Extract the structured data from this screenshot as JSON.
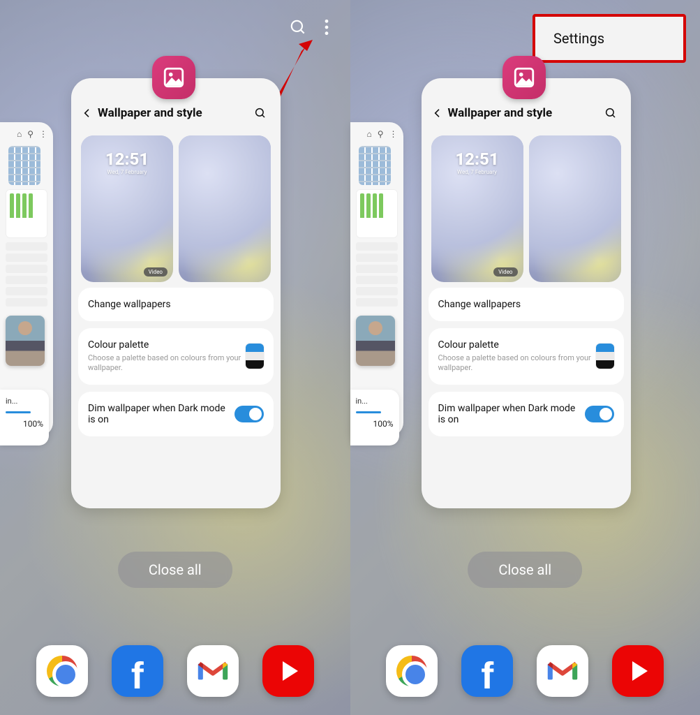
{
  "panels": {
    "left": {
      "top": {
        "has_search": true,
        "has_more": true,
        "show_arrow": true,
        "show_settings_popup": false
      }
    },
    "right": {
      "top": {
        "has_search": false,
        "has_more": false,
        "show_arrow": false,
        "show_settings_popup": true
      }
    },
    "settings_popup_label": "Settings"
  },
  "app_icon": {
    "name": "wallpaper-app-icon"
  },
  "card": {
    "title": "Wallpaper and style",
    "lock_time": "12:51",
    "lock_date": "Wed, 7 February",
    "video_badge": "Video",
    "rows": {
      "change": {
        "title": "Change wallpapers"
      },
      "palette": {
        "title": "Colour palette",
        "sub": "Choose a palette based on colours from your wallpaper."
      },
      "dim": {
        "title": "Dim wallpaper when Dark mode is on",
        "toggle_on": true
      }
    }
  },
  "side_download": {
    "label": "in...",
    "percent": "100%"
  },
  "close_all": "Close all",
  "dock": {
    "items": [
      "chrome",
      "facebook",
      "gmail",
      "youtube"
    ]
  }
}
